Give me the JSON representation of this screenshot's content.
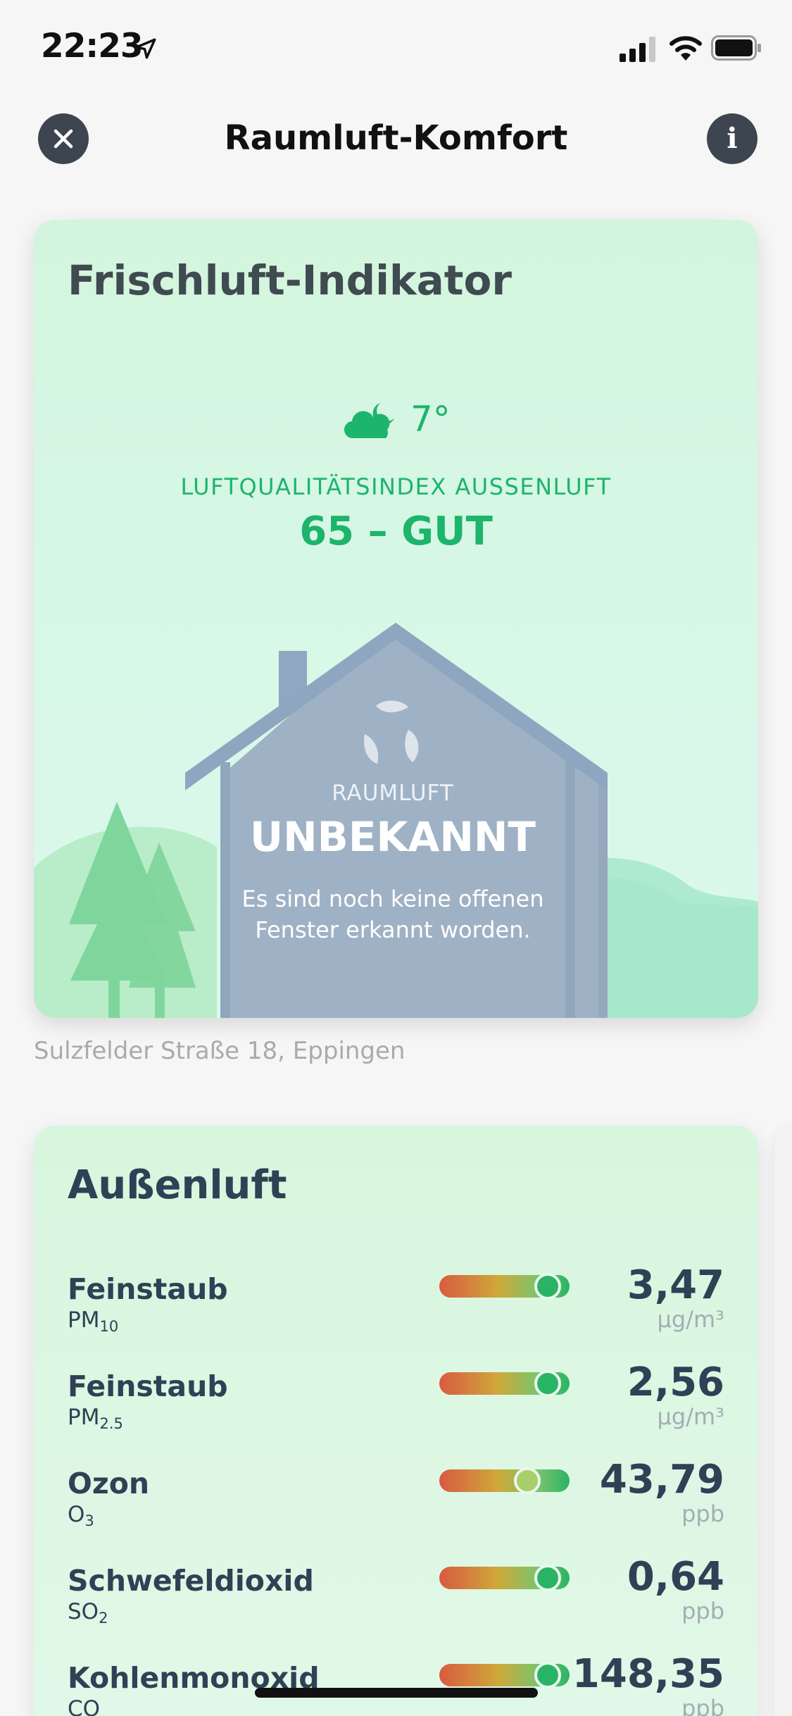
{
  "status_bar": {
    "time": "22:23",
    "icons": [
      "location-arrow-icon",
      "cellular-signal-icon",
      "wifi-icon",
      "battery-icon"
    ]
  },
  "nav": {
    "title": "Raumluft-Komfort",
    "close_icon": "close-icon",
    "info_label": "i"
  },
  "fresh_air_card": {
    "title": "Frischluft-Indikator",
    "weather_icon": "cloud-moon-icon",
    "temperature": "7°",
    "aqi_label": "LUFTQUALITÄTSINDEX AUSSENLUFT",
    "aqi_value": "65 – GUT",
    "indoor_label": "RAUMLUFT",
    "indoor_status": "UNBEKANNT",
    "indoor_message": "Es sind noch keine offenen Fenster erkannt worden.",
    "address": "Sulzfelder Straße 18, Eppingen"
  },
  "outdoor_card": {
    "title": "Außenluft",
    "pollutants": [
      {
        "name": "Feinstaub",
        "formula": "PM",
        "formula_sub": "10",
        "value": "3,47",
        "unit": "µg/m³",
        "level": 0.92
      },
      {
        "name": "Feinstaub",
        "formula": "PM",
        "formula_sub": "2.5",
        "value": "2,56",
        "unit": "µg/m³",
        "level": 0.92
      },
      {
        "name": "Ozon",
        "formula": "O",
        "formula_sub": "3",
        "value": "43,79",
        "unit": "ppb",
        "level": 0.72
      },
      {
        "name": "Schwefeldioxid",
        "formula": "SO",
        "formula_sub": "2",
        "value": "0,64",
        "unit": "ppb",
        "level": 0.92
      },
      {
        "name": "Kohlenmonoxid",
        "formula": "CO",
        "formula_sub": "",
        "value": "148,35",
        "unit": "ppb",
        "level": 0.92
      }
    ]
  },
  "colors": {
    "accent_green": "#1db46b",
    "house_gray": "#9fb1c4",
    "text_dark": "#2f4155"
  }
}
